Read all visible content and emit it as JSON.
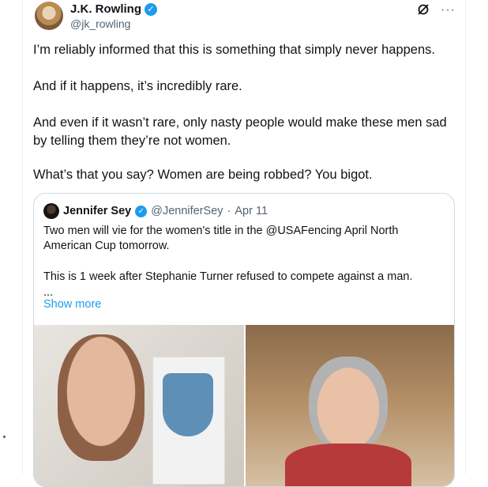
{
  "author": {
    "name": "J.K. Rowling",
    "handle": "@jk_rowling",
    "verified_mark": "✓"
  },
  "icons": {
    "grok": "grok-icon",
    "more": "···"
  },
  "tweet": {
    "p1": "I’m reliably informed that this is something that simply never happens.",
    "p2": "And if it happens, it’s incredibly rare.",
    "p3": "And even if it wasn’t rare,  only nasty people would make these men sad by telling them they’re not women.",
    "p4": "What’s that you say? Women are being robbed? You bigot."
  },
  "quote": {
    "name": "Jennifer Sey",
    "verified_mark": "✓",
    "handle": "@JenniferSey",
    "dot": "·",
    "date": "Apr 11",
    "text1": "Two men will vie for the women's title in the @USAFencing April North American Cup tomorrow.",
    "text2": "This is 1 week after Stephanie Turner refused to compete against a man.",
    "ellipsis": "...",
    "show_more": "Show more"
  },
  "colors": {
    "accent": "#1d9bf0",
    "text": "#0f1419",
    "muted": "#536471",
    "border": "#cfd9de"
  }
}
